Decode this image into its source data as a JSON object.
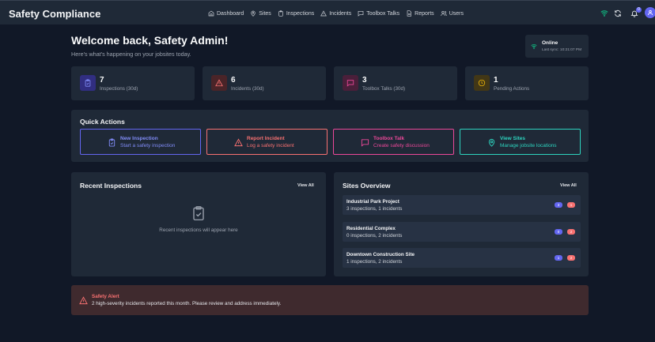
{
  "app": {
    "title": "Safety Compliance"
  },
  "nav": [
    {
      "label": "Dashboard",
      "icon": "home-icon"
    },
    {
      "label": "Sites",
      "icon": "map-pin-icon"
    },
    {
      "label": "Inspections",
      "icon": "clipboard-icon"
    },
    {
      "label": "Incidents",
      "icon": "alert-triangle-icon"
    },
    {
      "label": "Toolbox Talks",
      "icon": "message-square-icon"
    },
    {
      "label": "Reports",
      "icon": "file-text-icon"
    },
    {
      "label": "Users",
      "icon": "users-icon"
    }
  ],
  "notifications": {
    "count": "0"
  },
  "welcome": {
    "title": "Welcome back, Safety Admin!",
    "subtitle": "Here's what's happening on your jobsites today."
  },
  "status": {
    "label": "Online",
    "sync": "Last sync: 10:21:07 PM"
  },
  "stats": [
    {
      "value": "7",
      "label": "Inspections (30d)",
      "color": "#6366f1"
    },
    {
      "value": "6",
      "label": "Incidents (30d)",
      "color": "#f87171"
    },
    {
      "value": "3",
      "label": "Toolbox Talks (30d)",
      "color": "#ec4899"
    },
    {
      "value": "1",
      "label": "Pending Actions",
      "color": "#eab308"
    }
  ],
  "quick_actions": {
    "title": "Quick Actions",
    "items": [
      {
        "title": "New Inspection",
        "subtitle": "Start a safety inspection",
        "color": "#6366f1"
      },
      {
        "title": "Report Incident",
        "subtitle": "Log a safety incident",
        "color": "#f87171"
      },
      {
        "title": "Toolbox Talk",
        "subtitle": "Create safety discussion",
        "color": "#ec4899"
      },
      {
        "title": "View Sites",
        "subtitle": "Manage jobsite locations",
        "color": "#2dd4bf"
      }
    ]
  },
  "recent_inspections": {
    "title": "Recent Inspections",
    "view_all": "View All",
    "empty": "Recent inspections will appear here"
  },
  "sites_overview": {
    "title": "Sites Overview",
    "view_all": "View All",
    "sites": [
      {
        "name": "Industrial Park Project",
        "meta": "3 inspections, 1 incidents",
        "inspections": "3",
        "incidents": "1"
      },
      {
        "name": "Residential Complex",
        "meta": "0 inspections, 2 incidents",
        "inspections": "0",
        "incidents": "2"
      },
      {
        "name": "Downtown Construction Site",
        "meta": "1 inspections, 2 incidents",
        "inspections": "1",
        "incidents": "2"
      }
    ]
  },
  "alert": {
    "title": "Safety Alert",
    "message": "2 high-severity incidents reported this month. Please review and address immediately."
  }
}
